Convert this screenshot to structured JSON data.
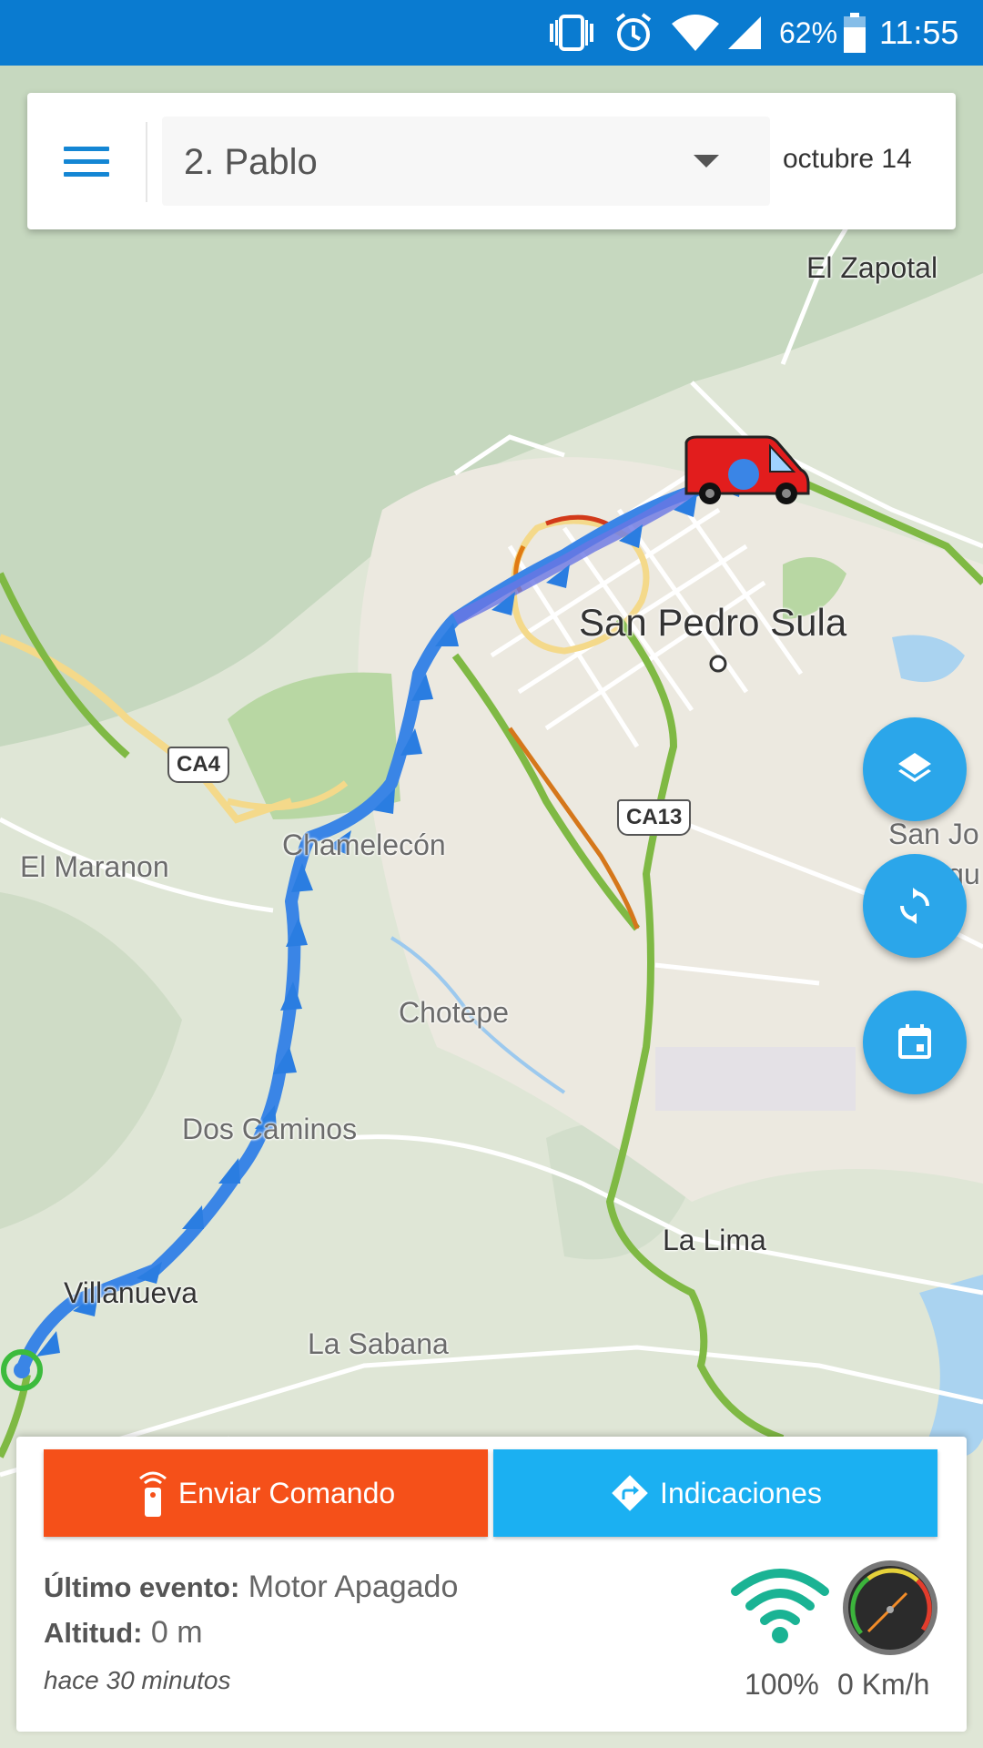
{
  "status_bar": {
    "battery": "62%",
    "time": "11:55",
    "icons": [
      "vibrate-icon",
      "alarm-icon",
      "wifi-icon",
      "cell-signal-icon",
      "battery-icon"
    ]
  },
  "top_card": {
    "menu_icon": "hamburger-menu-icon",
    "device_select": "2. Pablo",
    "date": "octubre 14"
  },
  "map": {
    "labels": {
      "el_zapotal": "El Zapotal",
      "san_pedro_sula": "San Pedro Sula",
      "el_maranon": "El Maranon",
      "chamelecon": "Chamelecón",
      "chotepe": "Chotepe",
      "dos_caminos": "Dos Caminos",
      "villanueva": "Villanueva",
      "la_sabana": "La Sabana",
      "la_lima": "La Lima",
      "san_jo": "San Jo",
      "boqu": "Boqu"
    },
    "shields": {
      "ca4": "CA4",
      "ca13": "CA13"
    },
    "vehicle_icon": "red-van-icon"
  },
  "fabs": [
    "layers-icon",
    "refresh-icon",
    "calendar-icon"
  ],
  "bottom_panel": {
    "send_command_label": "Enviar Comando",
    "directions_label": "Indicaciones",
    "last_event_label": "Último evento:",
    "last_event_value": "Motor Apagado",
    "altitude_label": "Altitud:",
    "altitude_value": "0 m",
    "time_ago": "hace 30 minutos",
    "signal": "100%",
    "speed": "0 Km/h"
  },
  "colors": {
    "status_bar": "#0a7bd0",
    "send_command": "#f55019",
    "directions": "#1bb0f2",
    "fab": "#2ba6ea",
    "route": "#2f86e8",
    "signal": "#1ab394"
  }
}
